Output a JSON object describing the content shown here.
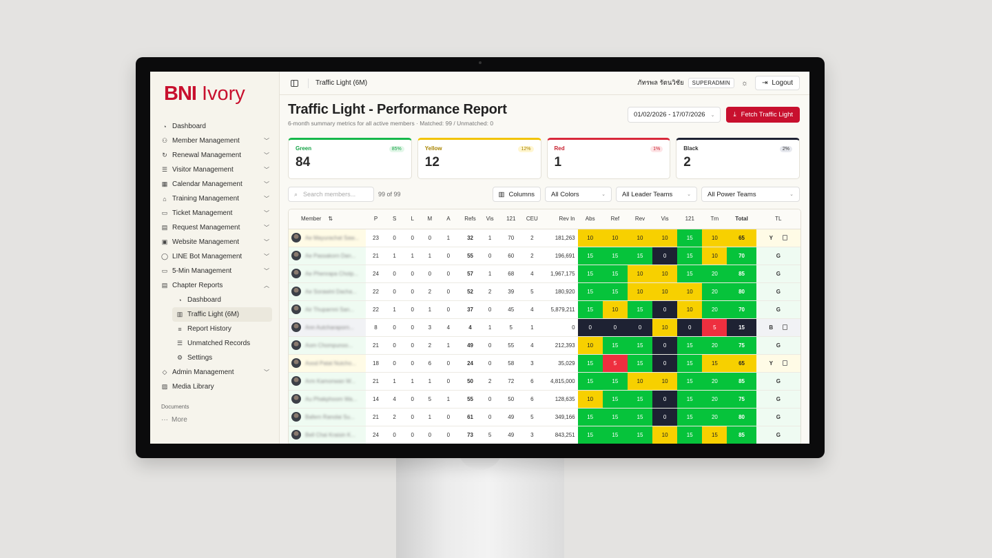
{
  "sidebar": {
    "logo_bni": "BNI",
    "logo_name": "Ivory",
    "items": [
      {
        "label": "Dashboard",
        "icon": "gauge-icon",
        "chevron": false
      },
      {
        "label": "Member Management",
        "icon": "users-icon",
        "chevron": true
      },
      {
        "label": "Renewal Management",
        "icon": "refresh-icon",
        "chevron": true
      },
      {
        "label": "Visitor Management",
        "icon": "list-icon",
        "chevron": true
      },
      {
        "label": "Calendar Management",
        "icon": "calendar-icon",
        "chevron": true
      },
      {
        "label": "Training Management",
        "icon": "graduation-cap-icon",
        "chevron": true
      },
      {
        "label": "Ticket Management",
        "icon": "ticket-icon",
        "chevron": true
      },
      {
        "label": "Request Management",
        "icon": "document-icon",
        "chevron": true
      },
      {
        "label": "Website Management",
        "icon": "browser-icon",
        "chevron": true
      },
      {
        "label": "LINE Bot Management",
        "icon": "chat-bubble-icon",
        "chevron": true
      },
      {
        "label": "5-Min Management",
        "icon": "presentation-icon",
        "chevron": true
      },
      {
        "label": "Chapter Reports",
        "icon": "report-icon",
        "chevron": true
      }
    ],
    "sub_items": [
      {
        "label": "Dashboard",
        "icon": "gauge-icon"
      },
      {
        "label": "Traffic Light (6M)",
        "icon": "bar-chart-icon"
      },
      {
        "label": "Report History",
        "icon": "database-icon"
      },
      {
        "label": "Unmatched Records",
        "icon": "list-check-icon"
      },
      {
        "label": "Settings",
        "icon": "gear-icon"
      }
    ],
    "bottom_items": [
      {
        "label": "Admin Management",
        "icon": "shield-icon",
        "chevron": true
      },
      {
        "label": "Media Library",
        "icon": "image-icon",
        "chevron": false
      }
    ],
    "section_label": "Documents",
    "more_label": "More"
  },
  "topbar": {
    "breadcrumb": "Traffic Light (6M)",
    "user_name": "ภัทรพล รัตนวิชัย",
    "role_badge": "SUPERADMIN",
    "logout_label": "Logout"
  },
  "page": {
    "title": "Traffic Light - Performance Report",
    "subtitle": "6-month summary metrics for all active members · Matched: 99 / Unmatched: 0",
    "date_range": "01/02/2026 - 17/07/2026",
    "fetch_label": "Fetch Traffic Light"
  },
  "cards": [
    {
      "label": "Green",
      "value": "84",
      "pct": "85%",
      "color": "#16b84a",
      "pct_bg": "#e3f7e9",
      "pct_fg": "#15a346"
    },
    {
      "label": "Yellow",
      "value": "12",
      "pct": "12%",
      "color": "#f2c300",
      "pct_bg": "#fff6d1",
      "pct_fg": "#a88400"
    },
    {
      "label": "Red",
      "value": "1",
      "pct": "1%",
      "color": "#d8283a",
      "pct_bg": "#fde4e6",
      "pct_fg": "#c8202f"
    },
    {
      "label": "Black",
      "value": "2",
      "pct": "2%",
      "color": "#1e2233",
      "pct_bg": "#e6e8ee",
      "pct_fg": "#333"
    }
  ],
  "filters": {
    "search_placeholder": "Search members...",
    "count_text": "99 of 99",
    "columns_label": "Columns",
    "colors_select": "All Colors",
    "leader_select": "All Leader Teams",
    "power_select": "All Power Teams"
  },
  "table": {
    "headers": [
      "Member",
      "P",
      "S",
      "L",
      "M",
      "A",
      "Refs",
      "Vis",
      "121",
      "CEU",
      "Rev In",
      "Abs",
      "Ref",
      "Rev",
      "Vis",
      "121",
      "Trn",
      "Total",
      "TL"
    ],
    "rows": [
      {
        "name": "Ae Mayurachat Saw...",
        "p": "23",
        "s": "0",
        "l": "0",
        "m": "0",
        "a": "1",
        "refs": "32",
        "vis": "1",
        "o121": "70",
        "ceu": "2",
        "rev_in": "181,263",
        "scores": [
          "10",
          "10",
          "10",
          "10",
          "15",
          "10"
        ],
        "score_colors": [
          "y",
          "y",
          "y",
          "y",
          "g",
          "y"
        ],
        "total": "65",
        "total_color": "y",
        "tl": "Y",
        "copy": true
      },
      {
        "name": "Ae Passakorn Dan...",
        "p": "21",
        "s": "1",
        "l": "1",
        "m": "1",
        "a": "0",
        "refs": "55",
        "vis": "0",
        "o121": "60",
        "ceu": "2",
        "rev_in": "196,691",
        "scores": [
          "15",
          "15",
          "15",
          "0",
          "15",
          "10"
        ],
        "score_colors": [
          "g",
          "g",
          "g",
          "b",
          "g",
          "y"
        ],
        "total": "70",
        "total_color": "g",
        "tl": "G",
        "copy": false
      },
      {
        "name": "Ae Phenrapa Chotp...",
        "p": "24",
        "s": "0",
        "l": "0",
        "m": "0",
        "a": "0",
        "refs": "57",
        "vis": "1",
        "o121": "68",
        "ceu": "4",
        "rev_in": "1,967,175",
        "scores": [
          "15",
          "15",
          "10",
          "10",
          "15",
          "20"
        ],
        "score_colors": [
          "g",
          "g",
          "y",
          "y",
          "g",
          "g"
        ],
        "total": "85",
        "total_color": "g",
        "tl": "G",
        "copy": false
      },
      {
        "name": "Ae Sorawini Dacha...",
        "p": "22",
        "s": "0",
        "l": "0",
        "m": "2",
        "a": "0",
        "refs": "52",
        "vis": "2",
        "o121": "39",
        "ceu": "5",
        "rev_in": "180,920",
        "scores": [
          "15",
          "15",
          "10",
          "10",
          "10",
          "20"
        ],
        "score_colors": [
          "g",
          "g",
          "y",
          "y",
          "y",
          "g"
        ],
        "total": "80",
        "total_color": "g",
        "tl": "G",
        "copy": false
      },
      {
        "name": "Air Thuparnni San...",
        "p": "22",
        "s": "1",
        "l": "0",
        "m": "1",
        "a": "0",
        "refs": "37",
        "vis": "0",
        "o121": "45",
        "ceu": "4",
        "rev_in": "5,879,211",
        "scores": [
          "15",
          "10",
          "15",
          "0",
          "10",
          "20"
        ],
        "score_colors": [
          "g",
          "y",
          "g",
          "b",
          "y",
          "g"
        ],
        "total": "70",
        "total_color": "g",
        "tl": "G",
        "copy": false
      },
      {
        "name": "Ann Autcharaporn...",
        "p": "8",
        "s": "0",
        "l": "0",
        "m": "3",
        "a": "4",
        "refs": "4",
        "vis": "1",
        "o121": "5",
        "ceu": "1",
        "rev_in": "0",
        "scores": [
          "0",
          "0",
          "0",
          "10",
          "0",
          "5"
        ],
        "score_colors": [
          "b",
          "b",
          "b",
          "y",
          "b",
          "r"
        ],
        "total": "15",
        "total_color": "b",
        "tl": "B",
        "copy": true
      },
      {
        "name": "Aom Chompunoo...",
        "p": "21",
        "s": "0",
        "l": "0",
        "m": "2",
        "a": "1",
        "refs": "49",
        "vis": "0",
        "o121": "55",
        "ceu": "4",
        "rev_in": "212,393",
        "scores": [
          "10",
          "15",
          "15",
          "0",
          "15",
          "20"
        ],
        "score_colors": [
          "y",
          "g",
          "g",
          "b",
          "g",
          "g"
        ],
        "total": "75",
        "total_color": "g",
        "tl": "G",
        "copy": false
      },
      {
        "name": "Aood Patat Nutcho...",
        "p": "18",
        "s": "0",
        "l": "0",
        "m": "6",
        "a": "0",
        "refs": "24",
        "vis": "0",
        "o121": "58",
        "ceu": "3",
        "rev_in": "35,029",
        "scores": [
          "15",
          "5",
          "15",
          "0",
          "15",
          "15"
        ],
        "score_colors": [
          "g",
          "r",
          "g",
          "b",
          "g",
          "y"
        ],
        "total": "65",
        "total_color": "y",
        "tl": "Y",
        "copy": true
      },
      {
        "name": "Arm Kamonwan W...",
        "p": "21",
        "s": "1",
        "l": "1",
        "m": "1",
        "a": "0",
        "refs": "50",
        "vis": "2",
        "o121": "72",
        "ceu": "6",
        "rev_in": "4,815,000",
        "scores": [
          "15",
          "15",
          "10",
          "10",
          "15",
          "20"
        ],
        "score_colors": [
          "g",
          "g",
          "y",
          "y",
          "g",
          "g"
        ],
        "total": "85",
        "total_color": "g",
        "tl": "G",
        "copy": false
      },
      {
        "name": "Au Phakphoom Wa...",
        "p": "14",
        "s": "4",
        "l": "0",
        "m": "5",
        "a": "1",
        "refs": "55",
        "vis": "0",
        "o121": "50",
        "ceu": "6",
        "rev_in": "128,635",
        "scores": [
          "10",
          "15",
          "15",
          "0",
          "15",
          "20"
        ],
        "score_colors": [
          "y",
          "g",
          "g",
          "b",
          "g",
          "g"
        ],
        "total": "75",
        "total_color": "g",
        "tl": "G",
        "copy": false
      },
      {
        "name": "Bafern Ranolai Su...",
        "p": "21",
        "s": "2",
        "l": "0",
        "m": "1",
        "a": "0",
        "refs": "61",
        "vis": "0",
        "o121": "49",
        "ceu": "5",
        "rev_in": "349,166",
        "scores": [
          "15",
          "15",
          "15",
          "0",
          "15",
          "20"
        ],
        "score_colors": [
          "g",
          "g",
          "g",
          "b",
          "g",
          "g"
        ],
        "total": "80",
        "total_color": "g",
        "tl": "G",
        "copy": false
      },
      {
        "name": "Bell Chai Kraisin K...",
        "p": "24",
        "s": "0",
        "l": "0",
        "m": "0",
        "a": "0",
        "refs": "73",
        "vis": "5",
        "o121": "49",
        "ceu": "3",
        "rev_in": "843,251",
        "scores": [
          "15",
          "15",
          "15",
          "10",
          "15",
          "15"
        ],
        "score_colors": [
          "g",
          "g",
          "g",
          "y",
          "g",
          "y"
        ],
        "total": "85",
        "total_color": "g",
        "tl": "G",
        "copy": false
      }
    ]
  }
}
